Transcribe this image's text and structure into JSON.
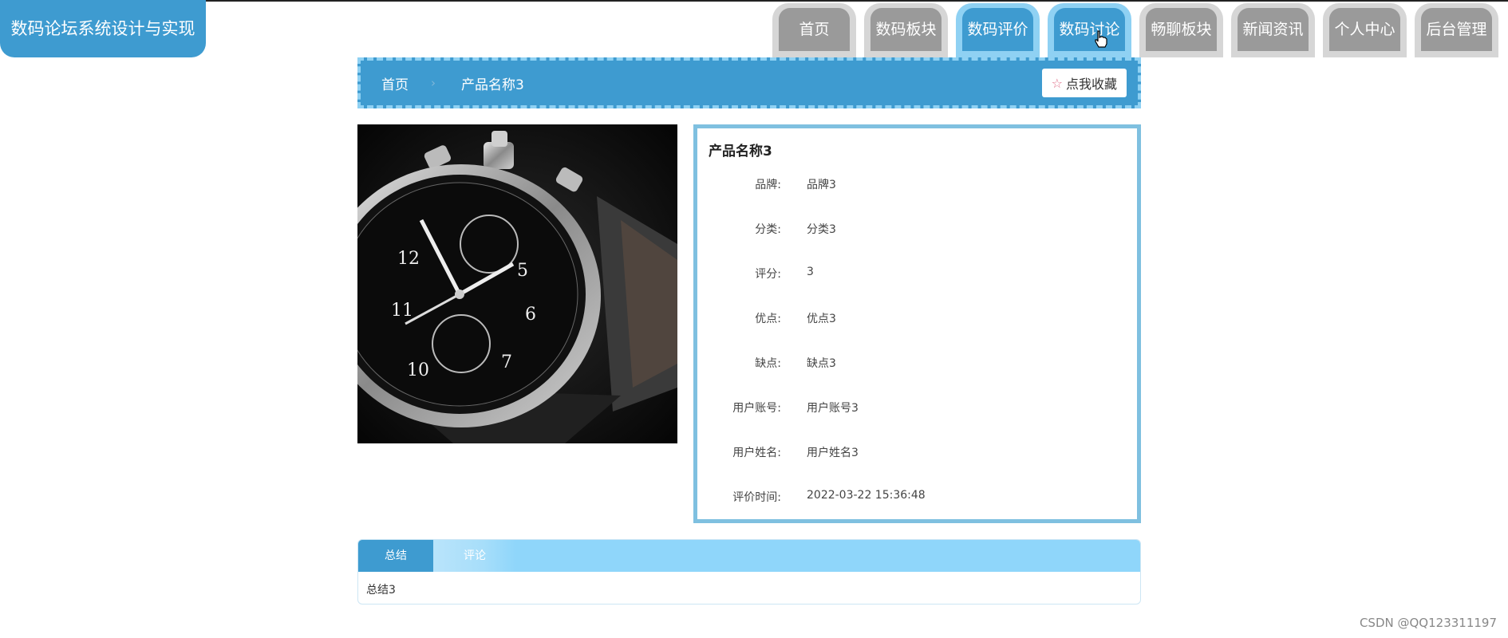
{
  "app": {
    "title": "数码论坛系统设计与实现"
  },
  "nav": {
    "items": [
      {
        "label": "首页",
        "active": false
      },
      {
        "label": "数码板块",
        "active": false
      },
      {
        "label": "数码评价",
        "active": true
      },
      {
        "label": "数码讨论",
        "active": true
      },
      {
        "label": "畅聊板块",
        "active": false
      },
      {
        "label": "新闻资讯",
        "active": false
      },
      {
        "label": "个人中心",
        "active": false
      },
      {
        "label": "后台管理",
        "active": false
      }
    ]
  },
  "breadcrumb": {
    "home": "首页",
    "separator": "›",
    "current": "产品名称3"
  },
  "favorite": {
    "label": "点我收藏",
    "icon": "star-outline-icon"
  },
  "product": {
    "image_alt": "watch-photo",
    "name": "产品名称3",
    "fields": [
      {
        "label": "品牌:",
        "value": "品牌3"
      },
      {
        "label": "分类:",
        "value": "分类3"
      },
      {
        "label": "评分:",
        "value": "3"
      },
      {
        "label": "优点:",
        "value": "优点3"
      },
      {
        "label": "缺点:",
        "value": "缺点3"
      },
      {
        "label": "用户账号:",
        "value": "用户账号3"
      },
      {
        "label": "用户姓名:",
        "value": "用户姓名3"
      },
      {
        "label": "评价时间:",
        "value": "2022-03-22 15:36:48"
      }
    ]
  },
  "tabs": {
    "items": [
      {
        "label": "总结",
        "active": true
      },
      {
        "label": "评论",
        "active": false
      }
    ],
    "content": "总结3"
  },
  "watermark": "CSDN @QQ123311197",
  "colors": {
    "primary": "#3e9bd0",
    "light": "#8fd6fa",
    "inactive_nav": "#9a9a9a"
  }
}
